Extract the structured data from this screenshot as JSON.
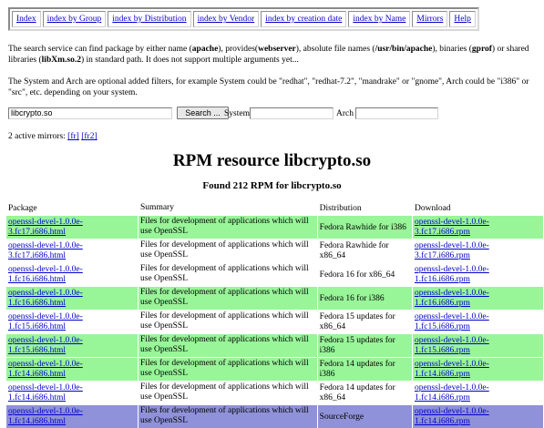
{
  "nav": [
    {
      "label": "Index"
    },
    {
      "label": "index by Group"
    },
    {
      "label": "index by Distribution"
    },
    {
      "label": "index by Vendor"
    },
    {
      "label": "index by creation date"
    },
    {
      "label": "index by Name"
    },
    {
      "label": "Mirrors"
    },
    {
      "label": "Help"
    }
  ],
  "intro": {
    "t1": "The search service can find package by either name (",
    "b1": "apache",
    "t2": "), provides(",
    "b2": "webserver",
    "t3": "), absolute file names (",
    "b3": "/usr/bin/apache",
    "t4": "), binaries (",
    "b4": "gprof",
    "t5": ") or shared libraries (",
    "b5": "libXm.so.2",
    "t6": ") in standard path. It does not support multiple arguments yet..."
  },
  "intro2": "The System and Arch are optional added filters, for example System could be \"redhat\", \"redhat-7.2\", \"mandrake\" or \"gnome\", Arch could be \"i386\" or \"src\", etc. depending on your system.",
  "search": {
    "query_value": "libcrypto.so",
    "button_label": "Search ...",
    "system_label": "System",
    "system_value": "",
    "arch_label": "Arch",
    "arch_value": ""
  },
  "mirrors": {
    "prefix": "2 active mirrors: ",
    "m1": "[fr]",
    "m2": "[fr2]"
  },
  "title": "RPM resource libcrypto.so",
  "subtitle": "Found 212 RPM for libcrypto.so",
  "columns": [
    "Package",
    "Summary",
    "Distribution",
    "Download"
  ],
  "colors": {
    "green": "#98f598",
    "light": "#ffffff",
    "header": "#ffffff",
    "sourceforge": "#8f92d8"
  },
  "rows": [
    {
      "package": "openssl-devel-1.0.0e-3.fc17.i686.html",
      "summary": "Files for development of applications which will use OpenSSL",
      "distribution": "Fedora Rawhide for i386",
      "download": "openssl-devel-1.0.0e-3.fc17.i686.rpm",
      "style": "green"
    },
    {
      "package": "openssl-devel-1.0.0e-3.fc17.i686.html",
      "summary": "Files for development of applications which will use OpenSSL",
      "distribution": "Fedora Rawhide for x86_64",
      "download": "openssl-devel-1.0.0e-3.fc17.i686.rpm",
      "style": "light"
    },
    {
      "package": "openssl-devel-1.0.0e-1.fc16.i686.html",
      "summary": "Files for development of applications which will use OpenSSL",
      "distribution": "Fedora 16 for x86_64",
      "download": "openssl-devel-1.0.0e-1.fc16.i686.rpm",
      "style": "light"
    },
    {
      "package": "openssl-devel-1.0.0e-1.fc16.i686.html",
      "summary": "Files for development of applications which will use OpenSSL",
      "distribution": "Fedora 16 for i386",
      "download": "openssl-devel-1.0.0e-1.fc16.i686.rpm",
      "style": "green"
    },
    {
      "package": "openssl-devel-1.0.0e-1.fc15.i686.html",
      "summary": "Files for development of applications which will use OpenSSL",
      "distribution": "Fedora 15 updates for x86_64",
      "download": "openssl-devel-1.0.0e-1.fc15.i686.rpm",
      "style": "light"
    },
    {
      "package": "openssl-devel-1.0.0e-1.fc15.i686.html",
      "summary": "Files for development of applications which will use OpenSSL",
      "distribution": "Fedora 15 updates for i386",
      "download": "openssl-devel-1.0.0e-1.fc15.i686.rpm",
      "style": "green"
    },
    {
      "package": "openssl-devel-1.0.0e-1.fc14.i686.html",
      "summary": "Files for development of applications which will use OpenSSL",
      "distribution": "Fedora 14 updates for i386",
      "download": "openssl-devel-1.0.0e-1.fc14.i686.rpm",
      "style": "green"
    },
    {
      "package": "openssl-devel-1.0.0e-1.fc14.i686.html",
      "summary": "Files for development of applications which will use OpenSSL",
      "distribution": "Fedora 14 updates for x86_64",
      "download": "openssl-devel-1.0.0e-1.fc14.i686.rpm",
      "style": "light"
    },
    {
      "package": "openssl-devel-1.0.0e-1.fc14.i686.html",
      "summary": "Files for development of applications which will use OpenSSL",
      "distribution": "SourceForge",
      "download": "openssl-devel-1.0.0e-1.fc14.i686.rpm",
      "style": "sourceforge"
    }
  ]
}
